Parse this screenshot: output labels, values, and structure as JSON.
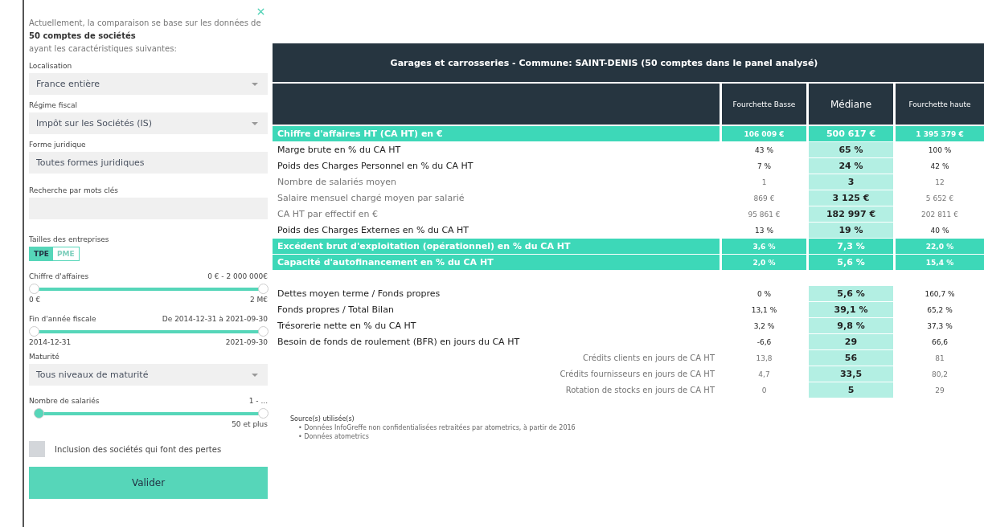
{
  "sidebar": {
    "intro": "Actuellement, la comparaison se base sur les données de",
    "count": "50 comptes de sociétés",
    "intro_end": "ayant les caractéristiques suivantes:",
    "fields": [
      {
        "kind": "select",
        "label": "Localisation",
        "value": "France entière"
      },
      {
        "kind": "select",
        "label": "Régime fiscal",
        "value": "Impôt sur les Sociétés (IS)"
      },
      {
        "kind": "text",
        "label": "Forme juridique",
        "value": "Toutes formes juridiques"
      },
      {
        "kind": "text",
        "label": "Recherche par mots clés"
      },
      {
        "kind": "toggle",
        "label": "Tailles des entreprises",
        "options": [
          {
            "label": "TPE",
            "selected": true
          },
          {
            "label": "PME",
            "selected": false
          }
        ]
      },
      {
        "kind": "range",
        "label": "Chiffre d'affaires",
        "reading": "0 € - 2 000 000€",
        "min_label": "0 €",
        "max_label": "2 M€",
        "level": 1,
        "focused": false
      },
      {
        "kind": "range",
        "label": "Fin d'année fiscale",
        "reading": "De 2014-12-31 à 2021-09-30",
        "min_label": "2014-12-31",
        "max_label": "2021-09-30",
        "level": 1,
        "focused": false
      },
      {
        "kind": "select",
        "label": "Maturité",
        "value": "Tous niveaux de maturité"
      },
      {
        "kind": "range",
        "label": "Nombre de salariés",
        "reading": "1 - ...",
        "max_label": "50 et plus",
        "level": 0.98,
        "focused": true
      },
      {
        "kind": "checkbox",
        "label": "Inclusion des sociétés qui font des pertes",
        "checked": false
      }
    ],
    "submit": "Valider"
  },
  "table": {
    "title": "Garages et carrosseries - Commune: SAINT-DENIS (50 comptes dans le panel analysé)",
    "columns": [
      "Fourchette Basse",
      "Médiane",
      "Fourchette haute"
    ],
    "sections": [
      [
        {
          "kind": "total",
          "label": "Chiffre d'affaires HT (CA HT) en €",
          "values": [
            "106 009 €",
            "500 617 €",
            "1 395 379 €"
          ]
        },
        {
          "kind": "main",
          "label": "Marge brute en % du CA HT",
          "values": [
            "43 %",
            "65 %",
            "100 %"
          ]
        },
        {
          "kind": "main",
          "label": "Poids des Charges Personnel en % du CA HT",
          "values": [
            "7 %",
            "24 %",
            "42 %"
          ]
        },
        {
          "kind": "secondary",
          "label": "Nombre de salariés moyen",
          "values": [
            "1",
            "3",
            "12"
          ]
        },
        {
          "kind": "secondary",
          "label": "Salaire mensuel chargé moyen par salarié",
          "values": [
            "869 €",
            "3 125 €",
            "5 652 €"
          ]
        },
        {
          "kind": "secondary",
          "label": "CA HT par effectif en €",
          "values": [
            "95 861 €",
            "182 997 €",
            "202 811 €"
          ]
        },
        {
          "kind": "main",
          "label": "Poids des Charges Externes en % du CA HT",
          "values": [
            "13 %",
            "19 %",
            "40 %"
          ]
        },
        {
          "kind": "total",
          "label": "Excédent brut d'exploitation (opérationnel) en % du CA HT",
          "values": [
            "3,6 %",
            "7,3 %",
            "22,0 %"
          ]
        },
        {
          "kind": "total",
          "label": "Capacité d'autofinancement en % du CA HT",
          "values": [
            "2,0 %",
            "5,6 %",
            "15,4 %"
          ]
        }
      ],
      [
        {
          "kind": "main",
          "label": "Dettes moyen terme / Fonds propres",
          "values": [
            "0 %",
            "5,6 %",
            "160,7 %"
          ]
        },
        {
          "kind": "main",
          "label": "Fonds propres / Total Bilan",
          "values": [
            "13,1 %",
            "39,1 %",
            "65,2 %"
          ]
        },
        {
          "kind": "main",
          "label": "Trésorerie nette en % du CA HT",
          "values": [
            "3,2 %",
            "9,8 %",
            "37,3 %"
          ]
        },
        {
          "kind": "main",
          "label": "Besoin de fonds de roulement (BFR) en jours du CA HT",
          "values": [
            "-6,6",
            "29",
            "66,6"
          ]
        },
        {
          "kind": "sub",
          "label": "Crédits clients en jours de CA HT",
          "values": [
            "13,8",
            "56",
            "81"
          ]
        },
        {
          "kind": "sub",
          "label": "Crédits fournisseurs en jours de CA HT",
          "values": [
            "4,7",
            "33,5",
            "80,2"
          ]
        },
        {
          "kind": "sub",
          "label": "Rotation de stocks en jours de CA HT",
          "values": [
            "0",
            "5",
            "29"
          ]
        }
      ]
    ]
  },
  "sources": {
    "title": "Source(s) utilisée(s)",
    "items": [
      "• Données InfoGreffe non confidentialisées retraitées par atometrics, à partir de 2016",
      "• Données atometrics"
    ]
  }
}
